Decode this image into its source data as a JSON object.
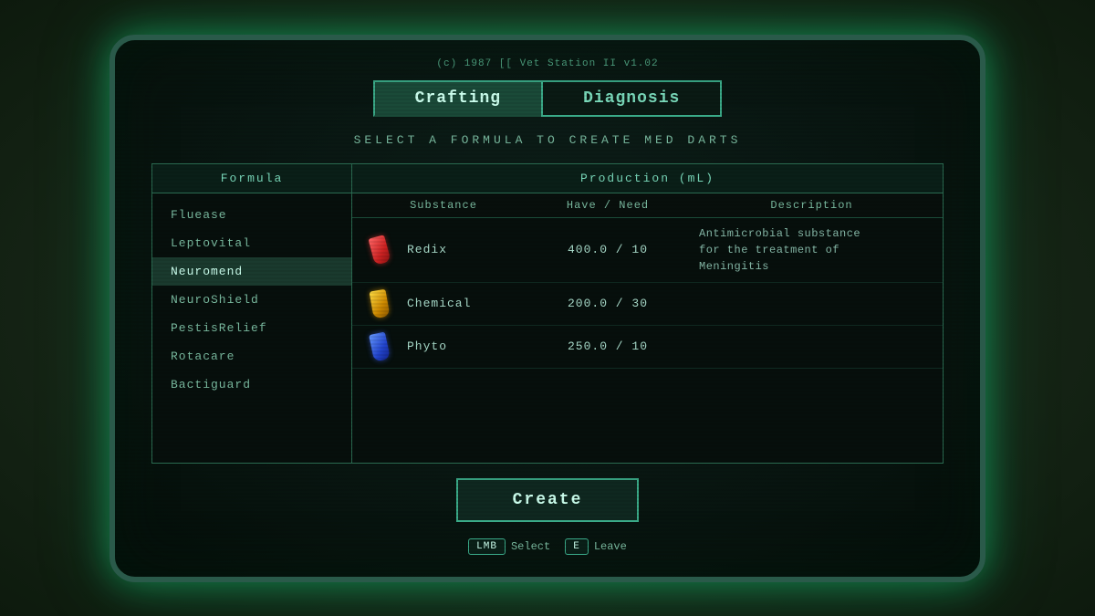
{
  "copyright": "(c) 1987 [[ Vet Station II v1.02",
  "tabs": [
    {
      "id": "crafting",
      "label": "Crafting",
      "active": true
    },
    {
      "id": "diagnosis",
      "label": "Diagnosis",
      "active": false
    }
  ],
  "subtitle": "SELECT A FORMULA TO CREATE MED DARTS",
  "formula_panel": {
    "header": "Formula",
    "items": [
      {
        "id": "fluease",
        "label": "Fluease",
        "selected": false
      },
      {
        "id": "leptovital",
        "label": "Leptovital",
        "selected": false
      },
      {
        "id": "neuromend",
        "label": "Neuromend",
        "selected": true
      },
      {
        "id": "neuroshield",
        "label": "NeuroShield",
        "selected": false
      },
      {
        "id": "pestisrelief",
        "label": "PestisRelief",
        "selected": false
      },
      {
        "id": "rotacare",
        "label": "Rotacare",
        "selected": false
      },
      {
        "id": "bactiguard",
        "label": "Bactiguard",
        "selected": false
      }
    ]
  },
  "production_panel": {
    "header": "Production (mL)",
    "col_substance": "Substance",
    "col_have_need": "Have / Need",
    "col_description": "Description",
    "substances": [
      {
        "id": "redix",
        "name": "Redix",
        "have": "400.0",
        "need": "10",
        "vial_color": "red",
        "description": "Antimicrobial substance for the treatment of Meningitis"
      },
      {
        "id": "chemical",
        "name": "Chemical",
        "have": "200.0",
        "need": "30",
        "vial_color": "yellow",
        "description": ""
      },
      {
        "id": "phyto",
        "name": "Phyto",
        "have": "250.0",
        "need": "10",
        "vial_color": "blue",
        "description": ""
      }
    ]
  },
  "create_button": "Create",
  "footer": {
    "hints": [
      {
        "key": "LMB",
        "label": "Select"
      },
      {
        "key": "E",
        "label": "Leave"
      }
    ]
  }
}
